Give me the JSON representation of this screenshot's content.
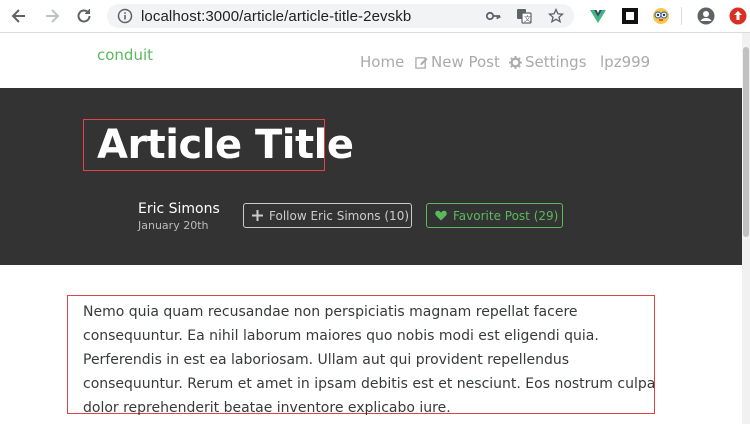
{
  "browser": {
    "url": "localhost:3000/article/article-title-2evskb"
  },
  "navbar": {
    "brand": "conduit",
    "links": {
      "home": "Home",
      "new_post": "New Post",
      "settings": "Settings",
      "user": "lpz999"
    }
  },
  "article": {
    "title": "Article Title",
    "author": {
      "name": "Eric Simons",
      "date": "January 20th"
    },
    "follow_label": "Follow Eric Simons (10)",
    "favorite_label": "Favorite Post (29)",
    "body": "Nemo quia quam recusandae non perspiciatis magnam repellat facere consequuntur. Ea nihil laborum maiores quo nobis modi est eligendi quia. Perferendis in est ea laboriosam. Ullam aut qui provident repellendus consequuntur. Rerum et amet in ipsam debitis est et nesciunt. Eos nostrum culpa dolor reprehenderit beatae inventore explicabo iure."
  },
  "colors": {
    "brand_green": "#5cb85c",
    "banner_bg": "#333333",
    "highlight_red": "#e04444"
  }
}
